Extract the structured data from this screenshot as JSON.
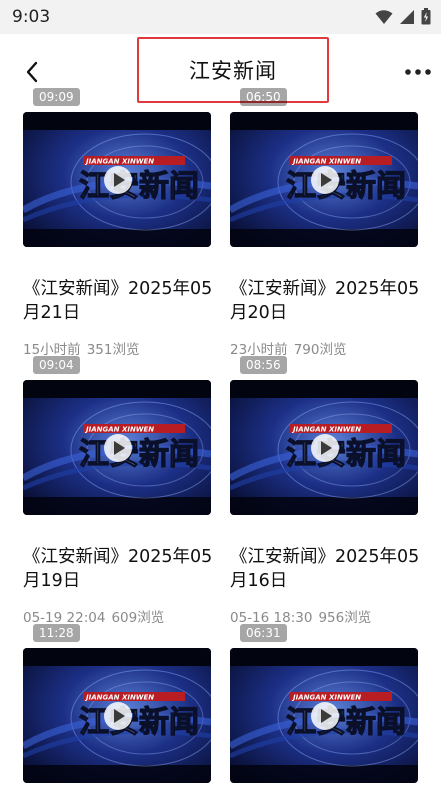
{
  "status": {
    "time": "9:03"
  },
  "header": {
    "title": "江安新闻"
  },
  "icons": {
    "back": "back-arrow-icon",
    "more": "more-dots-icon",
    "play": "play-icon"
  },
  "thumbnail_text": {
    "pinyin": "JIANGAN XINWEN",
    "chinese": "江安新闻"
  },
  "videos": [
    {
      "duration": "09:09",
      "title": "《江安新闻》2025年05月21日",
      "time": "15小时前",
      "views": "351浏览"
    },
    {
      "duration": "06:50",
      "title": "《江安新闻》2025年05月20日",
      "time": "23小时前",
      "views": "790浏览"
    },
    {
      "duration": "09:04",
      "title": "《江安新闻》2025年05月19日",
      "time": "05-19 22:04",
      "views": "609浏览"
    },
    {
      "duration": "08:56",
      "title": "《江安新闻》2025年05月16日",
      "time": "05-16 18:30",
      "views": "956浏览"
    },
    {
      "duration": "11:28",
      "title": "",
      "time": "",
      "views": ""
    },
    {
      "duration": "06:31",
      "title": "",
      "time": "",
      "views": ""
    }
  ]
}
